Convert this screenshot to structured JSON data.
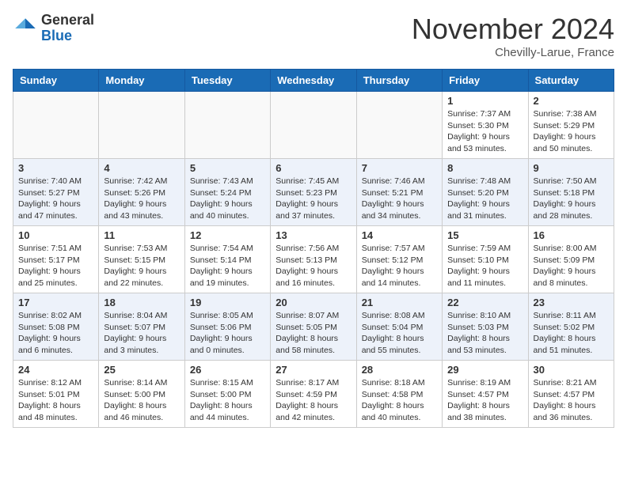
{
  "header": {
    "logo_general": "General",
    "logo_blue": "Blue",
    "month_title": "November 2024",
    "location": "Chevilly-Larue, France"
  },
  "weekdays": [
    "Sunday",
    "Monday",
    "Tuesday",
    "Wednesday",
    "Thursday",
    "Friday",
    "Saturday"
  ],
  "weeks": [
    [
      {
        "day": "",
        "info": ""
      },
      {
        "day": "",
        "info": ""
      },
      {
        "day": "",
        "info": ""
      },
      {
        "day": "",
        "info": ""
      },
      {
        "day": "",
        "info": ""
      },
      {
        "day": "1",
        "info": "Sunrise: 7:37 AM\nSunset: 5:30 PM\nDaylight: 9 hours\nand 53 minutes."
      },
      {
        "day": "2",
        "info": "Sunrise: 7:38 AM\nSunset: 5:29 PM\nDaylight: 9 hours\nand 50 minutes."
      }
    ],
    [
      {
        "day": "3",
        "info": "Sunrise: 7:40 AM\nSunset: 5:27 PM\nDaylight: 9 hours\nand 47 minutes."
      },
      {
        "day": "4",
        "info": "Sunrise: 7:42 AM\nSunset: 5:26 PM\nDaylight: 9 hours\nand 43 minutes."
      },
      {
        "day": "5",
        "info": "Sunrise: 7:43 AM\nSunset: 5:24 PM\nDaylight: 9 hours\nand 40 minutes."
      },
      {
        "day": "6",
        "info": "Sunrise: 7:45 AM\nSunset: 5:23 PM\nDaylight: 9 hours\nand 37 minutes."
      },
      {
        "day": "7",
        "info": "Sunrise: 7:46 AM\nSunset: 5:21 PM\nDaylight: 9 hours\nand 34 minutes."
      },
      {
        "day": "8",
        "info": "Sunrise: 7:48 AM\nSunset: 5:20 PM\nDaylight: 9 hours\nand 31 minutes."
      },
      {
        "day": "9",
        "info": "Sunrise: 7:50 AM\nSunset: 5:18 PM\nDaylight: 9 hours\nand 28 minutes."
      }
    ],
    [
      {
        "day": "10",
        "info": "Sunrise: 7:51 AM\nSunset: 5:17 PM\nDaylight: 9 hours\nand 25 minutes."
      },
      {
        "day": "11",
        "info": "Sunrise: 7:53 AM\nSunset: 5:15 PM\nDaylight: 9 hours\nand 22 minutes."
      },
      {
        "day": "12",
        "info": "Sunrise: 7:54 AM\nSunset: 5:14 PM\nDaylight: 9 hours\nand 19 minutes."
      },
      {
        "day": "13",
        "info": "Sunrise: 7:56 AM\nSunset: 5:13 PM\nDaylight: 9 hours\nand 16 minutes."
      },
      {
        "day": "14",
        "info": "Sunrise: 7:57 AM\nSunset: 5:12 PM\nDaylight: 9 hours\nand 14 minutes."
      },
      {
        "day": "15",
        "info": "Sunrise: 7:59 AM\nSunset: 5:10 PM\nDaylight: 9 hours\nand 11 minutes."
      },
      {
        "day": "16",
        "info": "Sunrise: 8:00 AM\nSunset: 5:09 PM\nDaylight: 9 hours\nand 8 minutes."
      }
    ],
    [
      {
        "day": "17",
        "info": "Sunrise: 8:02 AM\nSunset: 5:08 PM\nDaylight: 9 hours\nand 6 minutes."
      },
      {
        "day": "18",
        "info": "Sunrise: 8:04 AM\nSunset: 5:07 PM\nDaylight: 9 hours\nand 3 minutes."
      },
      {
        "day": "19",
        "info": "Sunrise: 8:05 AM\nSunset: 5:06 PM\nDaylight: 9 hours\nand 0 minutes."
      },
      {
        "day": "20",
        "info": "Sunrise: 8:07 AM\nSunset: 5:05 PM\nDaylight: 8 hours\nand 58 minutes."
      },
      {
        "day": "21",
        "info": "Sunrise: 8:08 AM\nSunset: 5:04 PM\nDaylight: 8 hours\nand 55 minutes."
      },
      {
        "day": "22",
        "info": "Sunrise: 8:10 AM\nSunset: 5:03 PM\nDaylight: 8 hours\nand 53 minutes."
      },
      {
        "day": "23",
        "info": "Sunrise: 8:11 AM\nSunset: 5:02 PM\nDaylight: 8 hours\nand 51 minutes."
      }
    ],
    [
      {
        "day": "24",
        "info": "Sunrise: 8:12 AM\nSunset: 5:01 PM\nDaylight: 8 hours\nand 48 minutes."
      },
      {
        "day": "25",
        "info": "Sunrise: 8:14 AM\nSunset: 5:00 PM\nDaylight: 8 hours\nand 46 minutes."
      },
      {
        "day": "26",
        "info": "Sunrise: 8:15 AM\nSunset: 5:00 PM\nDaylight: 8 hours\nand 44 minutes."
      },
      {
        "day": "27",
        "info": "Sunrise: 8:17 AM\nSunset: 4:59 PM\nDaylight: 8 hours\nand 42 minutes."
      },
      {
        "day": "28",
        "info": "Sunrise: 8:18 AM\nSunset: 4:58 PM\nDaylight: 8 hours\nand 40 minutes."
      },
      {
        "day": "29",
        "info": "Sunrise: 8:19 AM\nSunset: 4:57 PM\nDaylight: 8 hours\nand 38 minutes."
      },
      {
        "day": "30",
        "info": "Sunrise: 8:21 AM\nSunset: 4:57 PM\nDaylight: 8 hours\nand 36 minutes."
      }
    ]
  ]
}
